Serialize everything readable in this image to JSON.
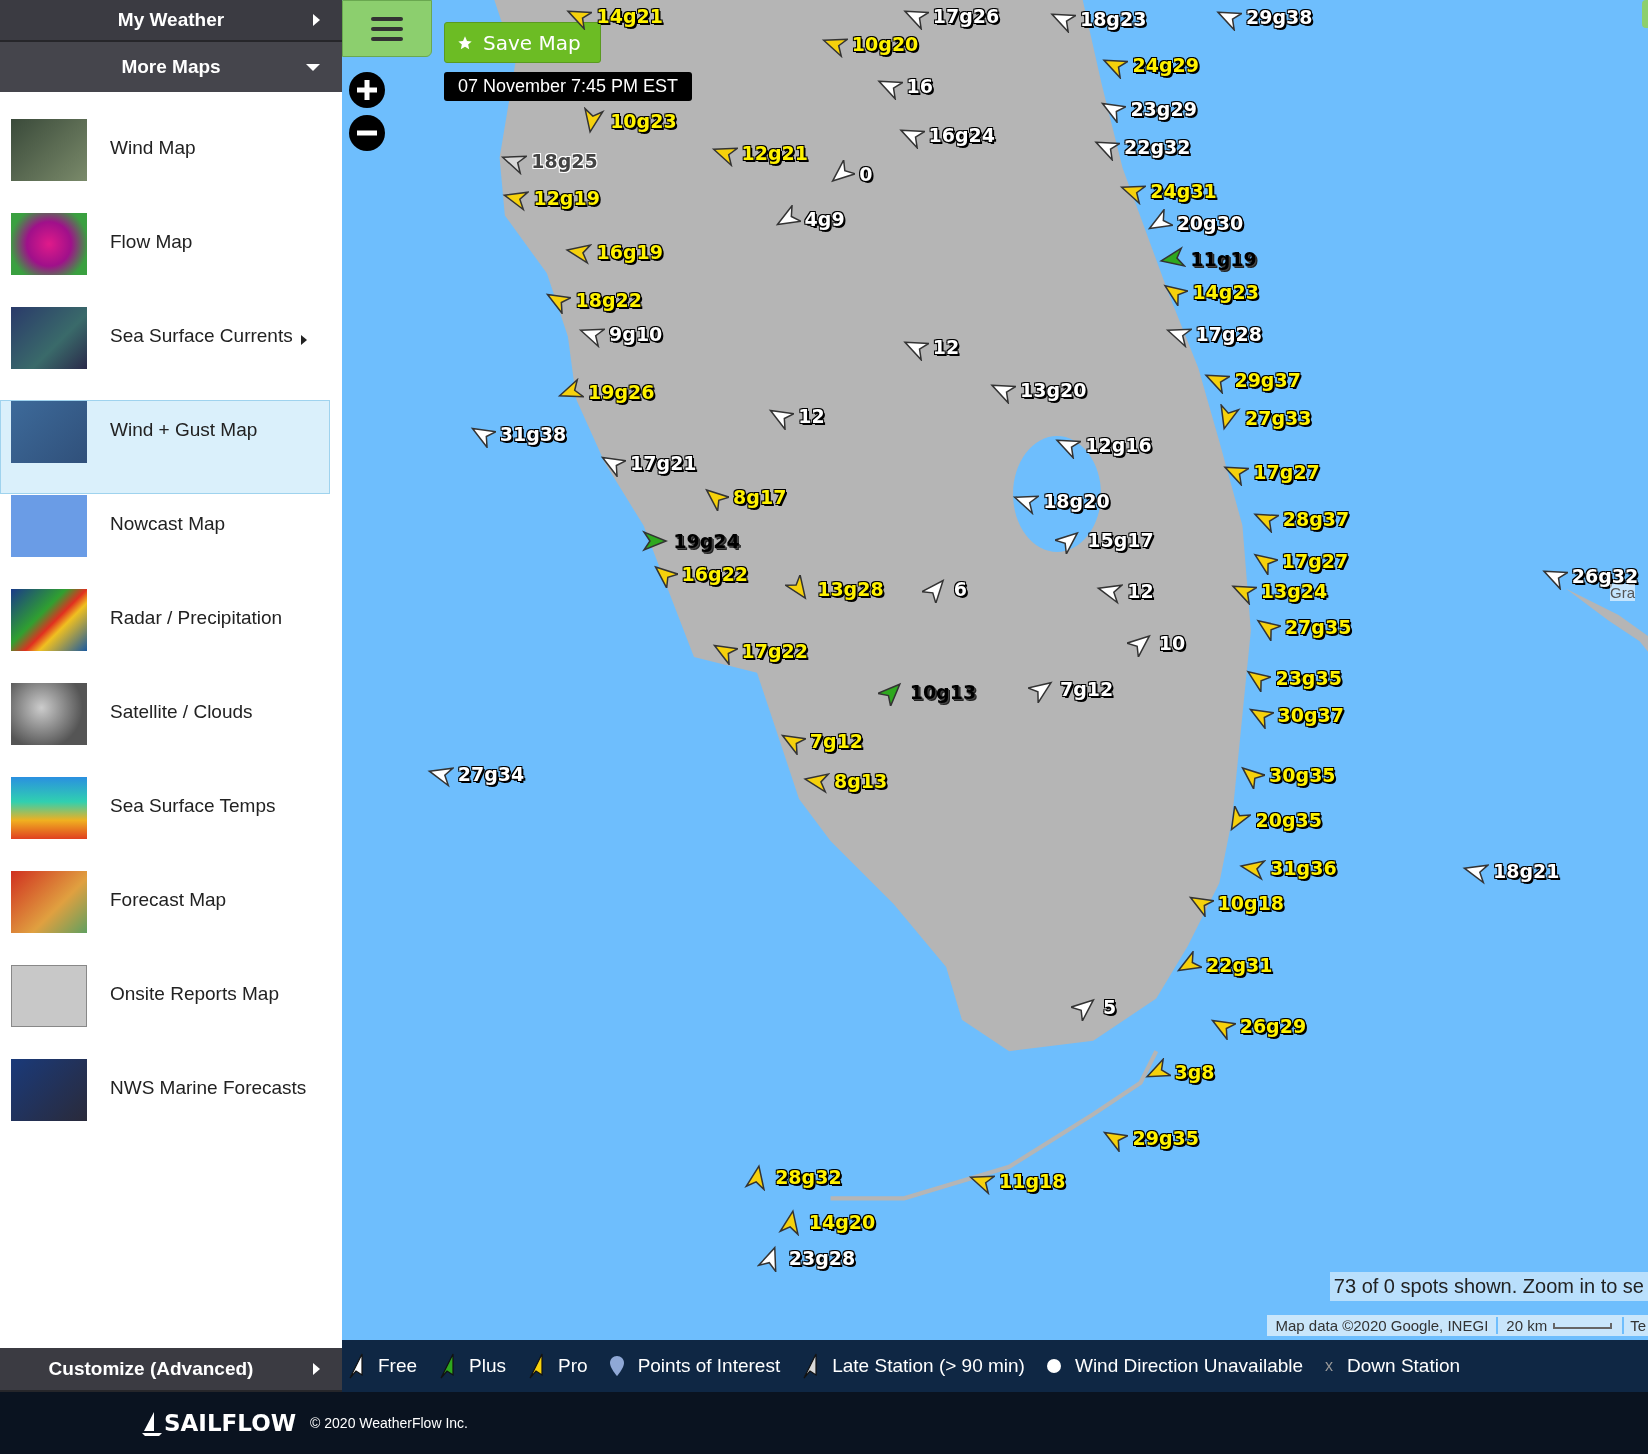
{
  "sidebar": {
    "header": {
      "label": "My Weather",
      "expanded": false
    },
    "section": {
      "label": "More Maps",
      "expanded": true
    },
    "items": [
      {
        "label": "Wind Map",
        "selected": false,
        "has_submenu": false
      },
      {
        "label": "Flow Map",
        "selected": false,
        "has_submenu": false
      },
      {
        "label": "Sea Surface Currents",
        "selected": false,
        "has_submenu": true
      },
      {
        "label": "Wind + Gust Map",
        "selected": true,
        "has_submenu": false
      },
      {
        "label": "Nowcast Map",
        "selected": false,
        "has_submenu": false
      },
      {
        "label": "Radar / Precipitation",
        "selected": false,
        "has_submenu": false
      },
      {
        "label": "Satellite / Clouds",
        "selected": false,
        "has_submenu": false
      },
      {
        "label": "Sea Surface Temps",
        "selected": false,
        "has_submenu": false
      },
      {
        "label": "Forecast Map",
        "selected": false,
        "has_submenu": false
      },
      {
        "label": "Onsite Reports Map",
        "selected": false,
        "has_submenu": false
      },
      {
        "label": "NWS Marine Forecasts",
        "selected": false,
        "has_submenu": false
      }
    ],
    "customize": {
      "label": "Customize (Advanced)",
      "expanded": false
    }
  },
  "map": {
    "save_button": "Save Map",
    "timestamp": "07 November 7:45 PM EST",
    "stations": [
      {
        "reading": "14g21",
        "kind": "pro"
      },
      {
        "reading": "17g26",
        "kind": "free"
      },
      {
        "reading": "18g23",
        "kind": "free"
      },
      {
        "reading": "29g38",
        "kind": "free"
      },
      {
        "reading": "10g20",
        "kind": "pro"
      },
      {
        "reading": "24g29",
        "kind": "pro"
      },
      {
        "reading": "16",
        "kind": "free"
      },
      {
        "reading": "23g29",
        "kind": "free"
      },
      {
        "reading": "10g23",
        "kind": "pro"
      },
      {
        "reading": "16g24",
        "kind": "free"
      },
      {
        "reading": "22g32",
        "kind": "free"
      },
      {
        "reading": "18g25",
        "kind": "late"
      },
      {
        "reading": "12g21",
        "kind": "pro"
      },
      {
        "reading": "0",
        "kind": "free"
      },
      {
        "reading": "12g19",
        "kind": "pro"
      },
      {
        "reading": "24g31",
        "kind": "pro"
      },
      {
        "reading": "4g9",
        "kind": "free"
      },
      {
        "reading": "20g30",
        "kind": "free"
      },
      {
        "reading": "11g19",
        "kind": "plus"
      },
      {
        "reading": "16g19",
        "kind": "pro"
      },
      {
        "reading": "14g23",
        "kind": "pro"
      },
      {
        "reading": "18g22",
        "kind": "pro"
      },
      {
        "reading": "9g10",
        "kind": "free"
      },
      {
        "reading": "17g28",
        "kind": "free"
      },
      {
        "reading": "12",
        "kind": "free"
      },
      {
        "reading": "29g37",
        "kind": "pro"
      },
      {
        "reading": "19g26",
        "kind": "pro"
      },
      {
        "reading": "13g20",
        "kind": "free"
      },
      {
        "reading": "27g33",
        "kind": "pro"
      },
      {
        "reading": "12",
        "kind": "free"
      },
      {
        "reading": "31g38",
        "kind": "free"
      },
      {
        "reading": "12g16",
        "kind": "free"
      },
      {
        "reading": "17g21",
        "kind": "free"
      },
      {
        "reading": "17g27",
        "kind": "pro"
      },
      {
        "reading": "8g17",
        "kind": "pro"
      },
      {
        "reading": "18g20",
        "kind": "free"
      },
      {
        "reading": "28g37",
        "kind": "pro"
      },
      {
        "reading": "19g24",
        "kind": "plus"
      },
      {
        "reading": "15g17",
        "kind": "free"
      },
      {
        "reading": "17g27",
        "kind": "pro"
      },
      {
        "reading": "16g22",
        "kind": "pro"
      },
      {
        "reading": "13g28",
        "kind": "pro"
      },
      {
        "reading": "6",
        "kind": "free"
      },
      {
        "reading": "12",
        "kind": "free"
      },
      {
        "reading": "13g24",
        "kind": "pro"
      },
      {
        "reading": "26g32",
        "kind": "free"
      },
      {
        "reading": "27g35",
        "kind": "pro"
      },
      {
        "reading": "10",
        "kind": "free"
      },
      {
        "reading": "17g22",
        "kind": "pro"
      },
      {
        "reading": "10g13",
        "kind": "plus"
      },
      {
        "reading": "7g12",
        "kind": "free"
      },
      {
        "reading": "23g35",
        "kind": "pro"
      },
      {
        "reading": "30g37",
        "kind": "pro"
      },
      {
        "reading": "7g12",
        "kind": "pro"
      },
      {
        "reading": "27g34",
        "kind": "free"
      },
      {
        "reading": "8g13",
        "kind": "pro"
      },
      {
        "reading": "30g35",
        "kind": "pro"
      },
      {
        "reading": "20g35",
        "kind": "pro"
      },
      {
        "reading": "31g36",
        "kind": "pro"
      },
      {
        "reading": "18g21",
        "kind": "free"
      },
      {
        "reading": "10g18",
        "kind": "pro"
      },
      {
        "reading": "22g31",
        "kind": "pro"
      },
      {
        "reading": "26g29",
        "kind": "pro"
      },
      {
        "reading": "5",
        "kind": "free"
      },
      {
        "reading": "3g8",
        "kind": "pro"
      },
      {
        "reading": "29g35",
        "kind": "pro"
      },
      {
        "reading": "28g32",
        "kind": "pro"
      },
      {
        "reading": "11g18",
        "kind": "pro"
      },
      {
        "reading": "14g20",
        "kind": "pro"
      },
      {
        "reading": "23g28",
        "kind": "free"
      }
    ],
    "place_label": "Gra",
    "spots_notice": "73 of 0 spots shown. Zoom in to se",
    "attribution": "Map data ©2020 Google, INEGI",
    "scale": "20 km",
    "attribution_extra": "Te"
  },
  "legend": [
    {
      "kind": "free",
      "label": "Free"
    },
    {
      "kind": "plus",
      "label": "Plus"
    },
    {
      "kind": "pro",
      "label": "Pro"
    },
    {
      "kind": "poi",
      "label": "Points of Interest"
    },
    {
      "kind": "late",
      "label": "Late Station (> 90 min)"
    },
    {
      "kind": "dot",
      "label": "Wind Direction Unavailable"
    },
    {
      "kind": "down",
      "label": "Down Station",
      "icon_text": "x"
    }
  ],
  "footer": {
    "brand": "SAILFLOW",
    "copyright": "© 2020 WeatherFlow Inc."
  }
}
